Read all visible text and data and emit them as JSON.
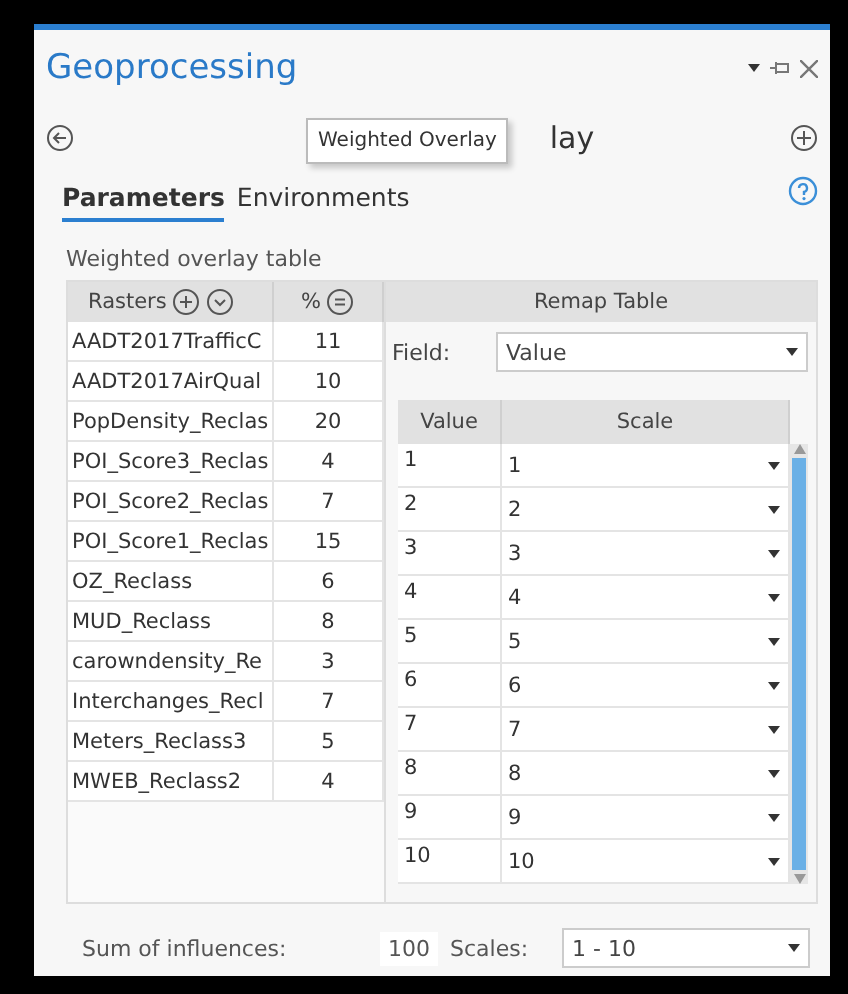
{
  "panel": {
    "title": "Geoprocessing"
  },
  "tool": {
    "title_visible": "lay",
    "tooltip": "Weighted Overlay"
  },
  "tabs": [
    {
      "label": "Parameters",
      "selected": true
    },
    {
      "label": "Environments",
      "selected": false
    }
  ],
  "overlay_table": {
    "label": "Weighted overlay table",
    "columns": {
      "rasters": "Rasters",
      "percent": "%",
      "remap": "Remap Table"
    },
    "rows": [
      {
        "raster": "AADT2017TrafficC",
        "percent": "11"
      },
      {
        "raster": "AADT2017AirQual",
        "percent": "10"
      },
      {
        "raster": "PopDensity_Reclas",
        "percent": "20"
      },
      {
        "raster": "POI_Score3_Reclas",
        "percent": "4"
      },
      {
        "raster": "POI_Score2_Reclas",
        "percent": "7"
      },
      {
        "raster": "POI_Score1_Reclas",
        "percent": "15"
      },
      {
        "raster": "OZ_Reclass",
        "percent": "6"
      },
      {
        "raster": "MUD_Reclass",
        "percent": "8"
      },
      {
        "raster": "carowndensity_Re",
        "percent": "3"
      },
      {
        "raster": "Interchanges_Recl",
        "percent": "7"
      },
      {
        "raster": "Meters_Reclass3",
        "percent": "5"
      },
      {
        "raster": "MWEB_Reclass2",
        "percent": "4"
      }
    ],
    "field_label": "Field:",
    "field_value": "Value",
    "remap_columns": [
      "Value",
      "Scale"
    ],
    "remap_rows": [
      {
        "value": "1",
        "scale": "1"
      },
      {
        "value": "2",
        "scale": "2"
      },
      {
        "value": "3",
        "scale": "3"
      },
      {
        "value": "4",
        "scale": "4"
      },
      {
        "value": "5",
        "scale": "5"
      },
      {
        "value": "6",
        "scale": "6"
      },
      {
        "value": "7",
        "scale": "7"
      },
      {
        "value": "8",
        "scale": "8"
      },
      {
        "value": "9",
        "scale": "9"
      },
      {
        "value": "10",
        "scale": "10"
      }
    ]
  },
  "footer": {
    "sum_label": "Sum of influences:",
    "sum_value": "100",
    "scales_label": "Scales:",
    "scales_value": "1 - 10"
  }
}
